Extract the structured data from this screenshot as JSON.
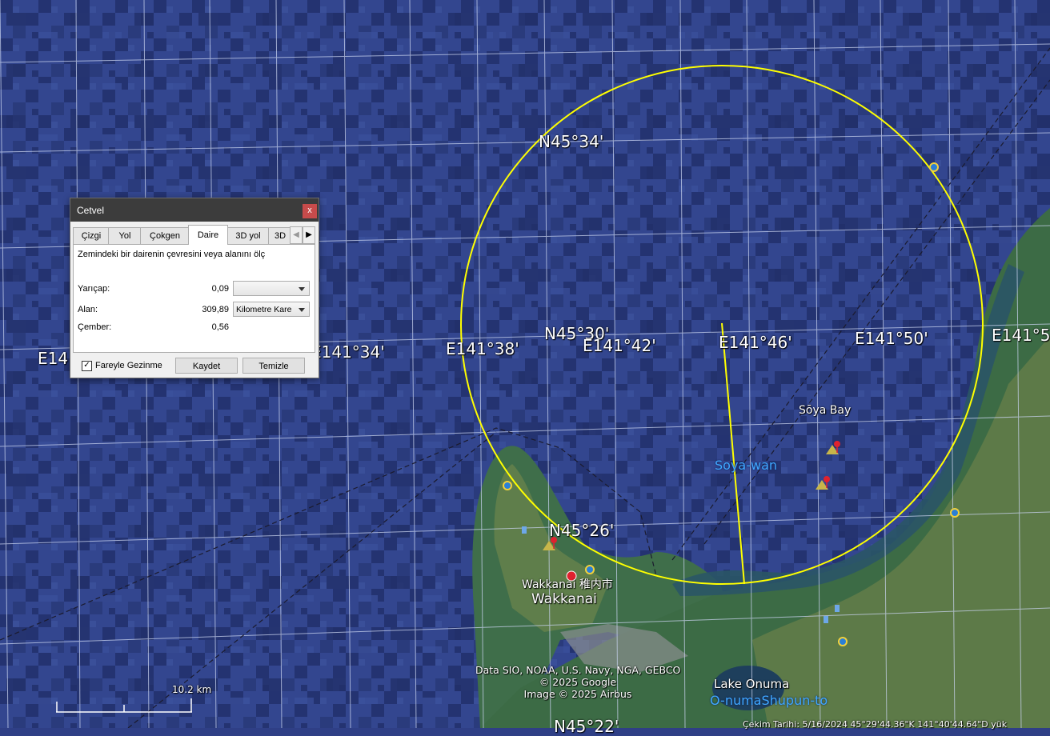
{
  "map": {
    "coords_lat": [
      "N45°34'",
      "N45°30'",
      "N45°26'",
      "N45°22'"
    ],
    "coords_lon": [
      "E14",
      "E141°34'",
      "E141°38'",
      "E141°42'",
      "E141°46'",
      "E141°50'",
      "E141°5"
    ],
    "places": {
      "soya_bay": "Sōya Bay",
      "soya_wan": "Soya-wan",
      "wakkanai_jp": "Wakkanai 稚内市",
      "wakkanai": "Wakkanai",
      "lake_onuma": "Lake Onuma",
      "onuma_shupun": "O-numaShupun-to"
    },
    "attribution": [
      "Data SIO, NOAA, U.S. Navy, NGA, GEBCO",
      "© 2025 Google",
      "Image © 2025 Airbus"
    ],
    "status_bar": "Çekim Tarihi: 5/16/2024     45°29'44.36\"K  141°40'44.64\"D  yük",
    "scale_label": "10.2 km",
    "colors": {
      "ocean": "#2f3f86",
      "measure_circle": "#ffff00",
      "sea_label": "#3fa7ff"
    }
  },
  "ruler": {
    "title": "Cetvel",
    "close": "x",
    "tabs": [
      "Çizgi",
      "Yol",
      "Çokgen",
      "Daire",
      "3D yol",
      "3D"
    ],
    "active_tab": "Daire",
    "description": "Zemindeki bir dairenin çevresini veya alanını ölç",
    "radius": {
      "label": "Yarıçap:",
      "value": "0,09",
      "unit": ""
    },
    "area": {
      "label": "Alan:",
      "value": "309,89",
      "unit": "Kilometre Kare"
    },
    "circumference": {
      "label": "Çember:",
      "value": "0,56"
    },
    "mouse_nav": {
      "label": "Fareyle Gezinme",
      "checked": "✓"
    },
    "save_button": "Kaydet",
    "clear_button": "Temizle"
  }
}
